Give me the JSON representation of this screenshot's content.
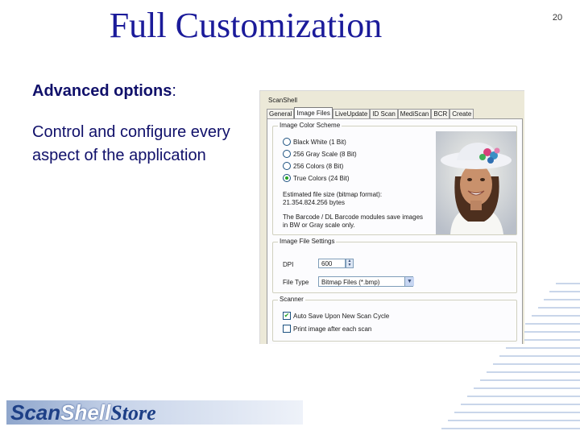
{
  "slide": {
    "title": "Full Customization",
    "number": "20",
    "bullet1_bold": "Advanced options",
    "bullet1_rest": ":",
    "bullet2_line1": "Control and configure every",
    "bullet2_line2": "aspect of the application"
  },
  "logo": {
    "part1": "Scan",
    "part2": "Shell",
    "part3": "Store"
  },
  "dialog": {
    "title": "ScanShell",
    "tabs": [
      {
        "label": "General",
        "active": false
      },
      {
        "label": "Image Files",
        "active": true
      },
      {
        "label": "LiveUpdate",
        "active": false
      },
      {
        "label": "ID Scan",
        "active": false
      },
      {
        "label": "MediScan",
        "active": false
      },
      {
        "label": "BCR",
        "active": false
      },
      {
        "label": "Create",
        "active": false
      }
    ],
    "color_scheme": {
      "label": "Image Color Scheme",
      "options": [
        {
          "label": "Black White (1 Bit)",
          "selected": false
        },
        {
          "label": "256 Gray Scale (8 Bit)",
          "selected": false
        },
        {
          "label": "256 Colors (8 Bit)",
          "selected": false
        },
        {
          "label": "True Colors (24 Bit)",
          "selected": true
        }
      ],
      "size_line1": "Estimated file size (bitmap format):",
      "size_line2": "21.354.824.256 bytes",
      "note_line1": "The Barcode / DL Barcode modules save images",
      "note_line2": "in BW or Gray scale only."
    },
    "file_settings": {
      "label": "Image File Settings",
      "dpi_label": "DPI",
      "dpi_value": "600",
      "filetype_label": "File Type",
      "filetype_value": "Bitmap Files (*.bmp)"
    },
    "scanner": {
      "label": "Scanner",
      "options": [
        {
          "label": "Auto Save Upon New Scan Cycle",
          "checked": true
        },
        {
          "label": "Print image after each scan",
          "checked": false
        }
      ]
    }
  }
}
